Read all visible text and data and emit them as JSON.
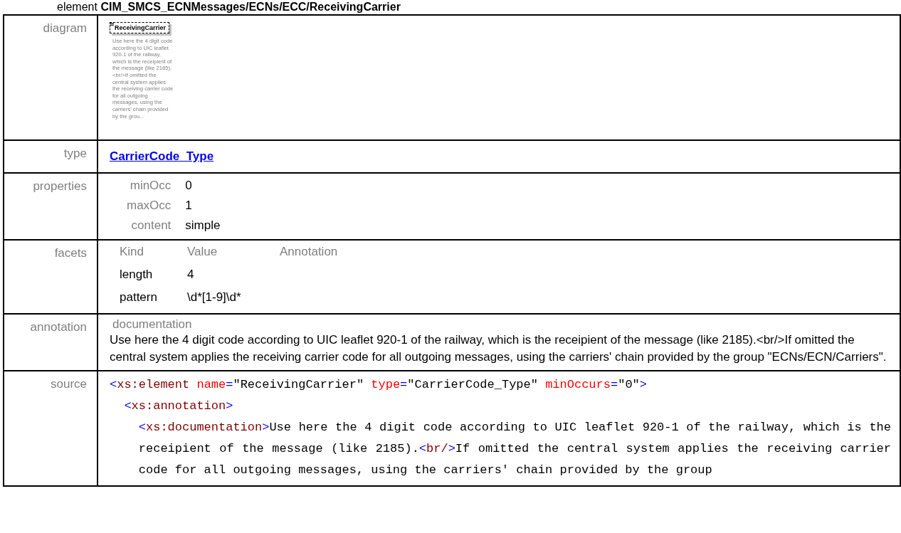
{
  "heading": {
    "prefix": "element",
    "path": "CIM_SMCS_ECNMessages/ECNs/ECC/ReceivingCarrier"
  },
  "diagram": {
    "label": "diagram",
    "element_name": "ReceivingCarrier",
    "description": "Use here the 4 digit code according to UIC leaflet 920-1 of the railway, which is the receipient of the message (like 2185).<br/>If omitted the central system applies the receiving carrier code for all outgoing messages, using the carriers' chain provided by the grou..."
  },
  "type": {
    "label": "type",
    "link": "CarrierCode_Type"
  },
  "properties": {
    "label": "properties",
    "items": [
      {
        "name": "minOcc",
        "value": "0"
      },
      {
        "name": "maxOcc",
        "value": "1"
      },
      {
        "name": "content",
        "value": "simple"
      }
    ]
  },
  "facets": {
    "label": "facets",
    "columns": [
      "Kind",
      "Value",
      "Annotation"
    ],
    "rows": [
      {
        "kind": "length",
        "value": "4"
      },
      {
        "kind": "pattern",
        "value": "\\d*[1-9]\\d*"
      }
    ]
  },
  "annotation": {
    "label": "annotation",
    "title": "documentation",
    "text": "Use here the 4 digit code according to UIC leaflet 920-1 of the railway, which is the receipient of the message (like 2185).<br/>If omitted the central system applies the receiving carrier code for all outgoing messages, using the carriers' chain provided by the group \"ECNs/ECN/Carriers\"."
  },
  "source": {
    "label": "source",
    "lines": [
      {
        "tokens": [
          {
            "kind": "punct",
            "text": "<"
          },
          {
            "kind": "tag",
            "text": "xs:element"
          },
          {
            "kind": "attr",
            "text": " name"
          },
          {
            "kind": "punct",
            "text": "="
          },
          {
            "kind": "value",
            "text": "\"ReceivingCarrier\""
          },
          {
            "kind": "attr",
            "text": " type"
          },
          {
            "kind": "punct",
            "text": "="
          },
          {
            "kind": "value",
            "text": "\"CarrierCode_Type\""
          },
          {
            "kind": "attr",
            "text": " minOccurs"
          },
          {
            "kind": "punct",
            "text": "="
          },
          {
            "kind": "value",
            "text": "\"0\""
          },
          {
            "kind": "punct",
            "text": ">"
          }
        ],
        "children": [
          {
            "tokens": [
              {
                "kind": "punct",
                "text": "<"
              },
              {
                "kind": "tag",
                "text": "xs:annotation"
              },
              {
                "kind": "punct",
                "text": ">"
              }
            ],
            "children": [
              {
                "tokens": [
                  {
                    "kind": "punct",
                    "text": "<"
                  },
                  {
                    "kind": "tag",
                    "text": "xs:documentation"
                  },
                  {
                    "kind": "punct",
                    "text": ">"
                  },
                  {
                    "kind": "text",
                    "text": "Use here the 4 digit code according to UIC leaflet 920-1 of the railway, which is the receipient of the message (like 2185)."
                  },
                  {
                    "kind": "punct",
                    "text": "<"
                  },
                  {
                    "kind": "tag",
                    "text": "br/"
                  },
                  {
                    "kind": "punct",
                    "text": ">"
                  },
                  {
                    "kind": "text",
                    "text": "If omitted the central system applies the receiving carrier code for all outgoing messages, using the carriers' chain provided by the group"
                  }
                ]
              }
            ]
          }
        ]
      }
    ]
  }
}
